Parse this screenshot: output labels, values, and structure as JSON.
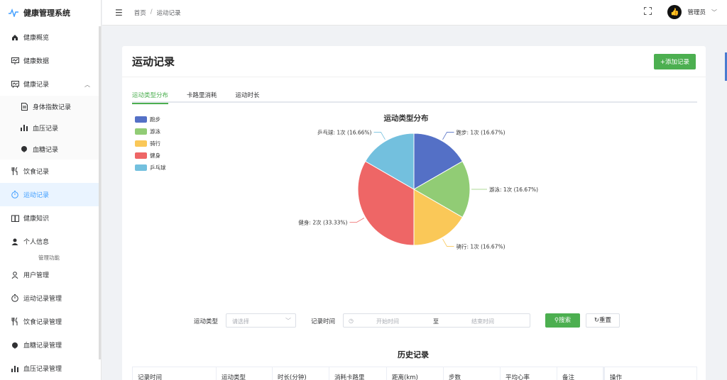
{
  "app": {
    "title": "健康管理系统"
  },
  "sidebar": {
    "items": [
      {
        "label": "健康概览",
        "icon": "home-icon"
      },
      {
        "label": "健康数据",
        "icon": "monitor-chart-icon"
      },
      {
        "label": "健康记录",
        "icon": "presentation-icon"
      },
      {
        "label": "身体指数记录",
        "icon": "document-icon"
      },
      {
        "label": "血压记录",
        "icon": "bar-chart-icon"
      },
      {
        "label": "血糖记录",
        "icon": "drop-icon"
      },
      {
        "label": "饮食记录",
        "icon": "fork-knife-icon"
      },
      {
        "label": "运动记录",
        "icon": "timer-icon"
      },
      {
        "label": "健康知识",
        "icon": "book-icon"
      },
      {
        "label": "个人信息",
        "icon": "user-icon"
      },
      {
        "label": "用户管理",
        "icon": "user-outline-icon"
      },
      {
        "label": "运动记录管理",
        "icon": "timer-icon"
      },
      {
        "label": "饮食记录管理",
        "icon": "fork-knife-icon"
      },
      {
        "label": "血糖记录管理",
        "icon": "drop-icon"
      },
      {
        "label": "血压记录管理",
        "icon": "bar-chart-icon"
      }
    ],
    "group_title": "管理功能"
  },
  "header": {
    "breadcrumb": [
      "首页",
      "运动记录"
    ],
    "separator": "/",
    "user": "管理员"
  },
  "page": {
    "title": "运动记录",
    "add_button": "+添加记录",
    "tabs": [
      "运动类型分布",
      "卡路里消耗",
      "运动时长"
    ],
    "active_tab": 0
  },
  "chart_data": {
    "type": "pie",
    "title": "运动类型分布",
    "legend_position": "top-left",
    "slices": [
      {
        "name": "跑步",
        "value": 1,
        "label": "跑步: 1次 (16.67%)",
        "color": "#5470c6"
      },
      {
        "name": "游泳",
        "value": 1,
        "label": "游泳: 1次 (16.67%)",
        "color": "#91cc75"
      },
      {
        "name": "骑行",
        "value": 1,
        "label": "骑行: 1次 (16.67%)",
        "color": "#fac858"
      },
      {
        "name": "健身",
        "value": 2,
        "label": "健身: 2次 (33.33%)",
        "color": "#ee6666"
      },
      {
        "name": "乒乓球",
        "value": 1,
        "label": "乒乓球: 1次 (16.66%)",
        "color": "#73c0de"
      }
    ]
  },
  "filters": {
    "type_label": "运动类型",
    "type_placeholder": "请选择",
    "time_label": "记录时间",
    "start_placeholder": "开始时间",
    "range_separator": "至",
    "end_placeholder": "结束时间",
    "search_button": "搜索",
    "reset_button": "重置"
  },
  "history": {
    "title": "历史记录",
    "columns": [
      "记录时间",
      "运动类型",
      "时长(分钟)",
      "消耗卡路里",
      "距离(km)",
      "步数",
      "平均心率",
      "备注",
      "操作"
    ]
  }
}
